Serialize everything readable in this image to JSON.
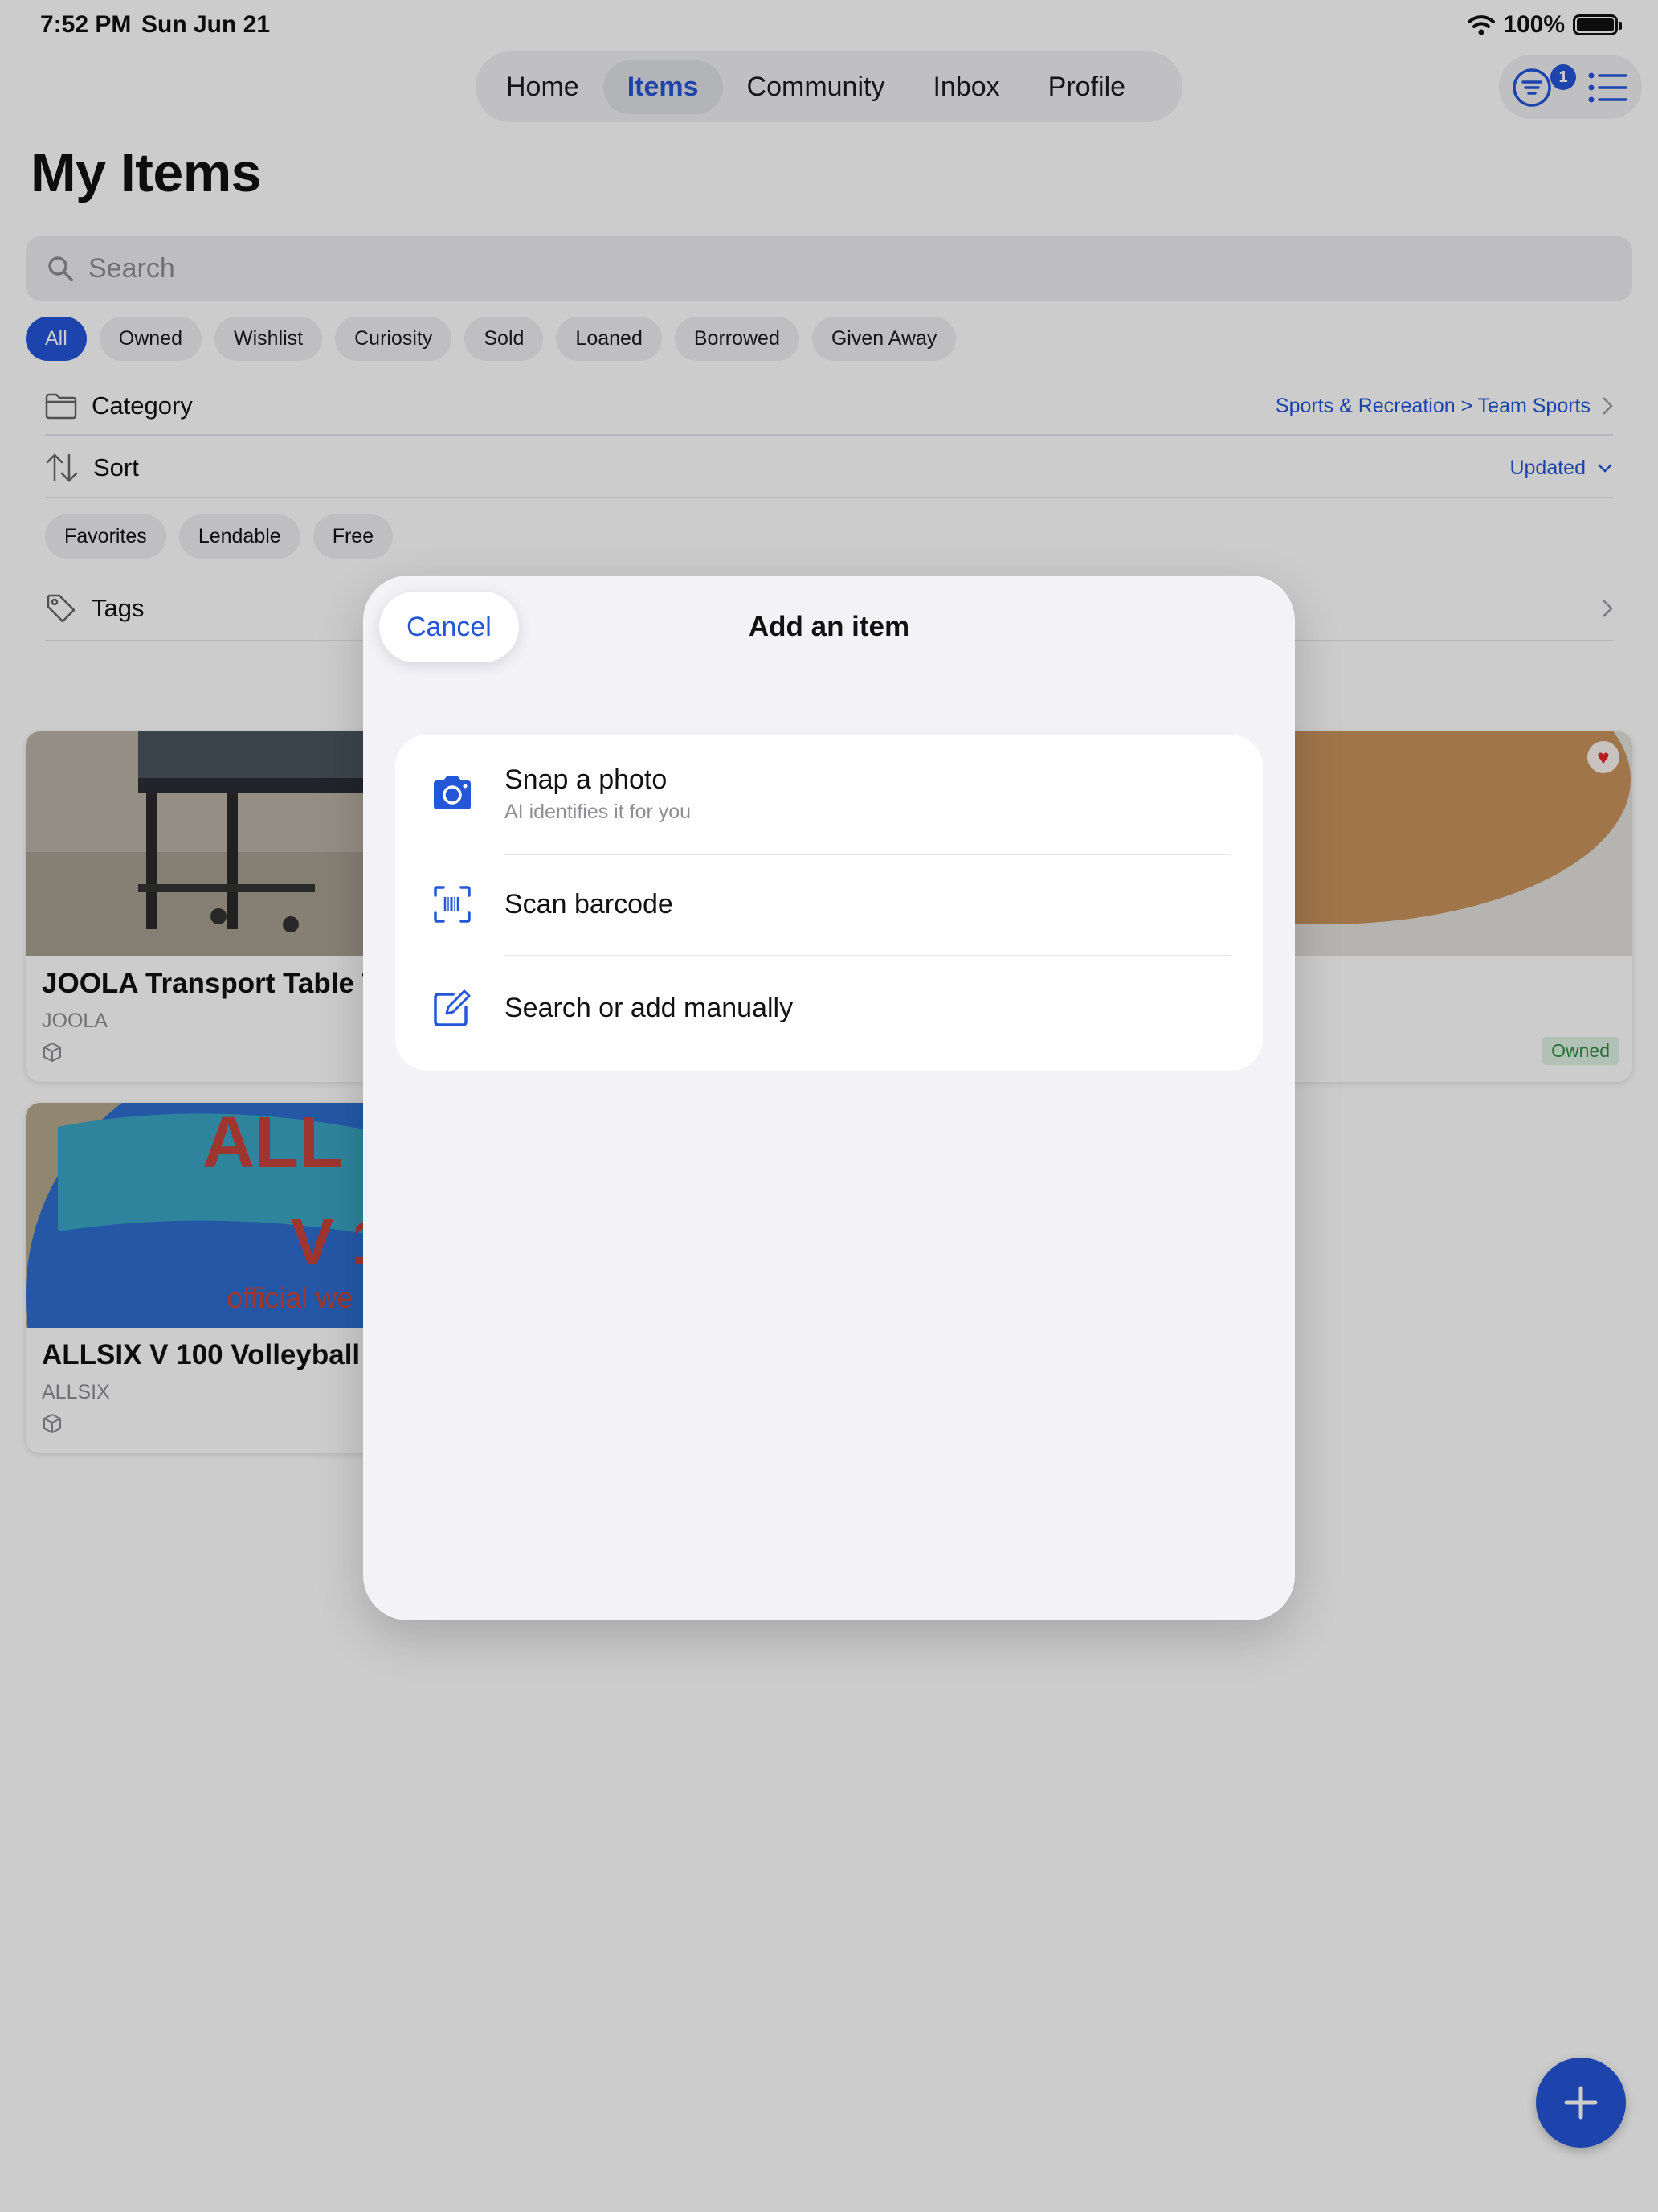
{
  "status": {
    "time": "7:52 PM",
    "date": "Sun Jun 21",
    "battery": "100%"
  },
  "nav": {
    "tabs": [
      {
        "label": "Home"
      },
      {
        "label": "Items"
      },
      {
        "label": "Community"
      },
      {
        "label": "Inbox"
      },
      {
        "label": "Profile"
      }
    ],
    "active_tab": "Items",
    "filter_badge": "1"
  },
  "page": {
    "title": "My Items"
  },
  "search": {
    "placeholder": "Search"
  },
  "filters": {
    "chips": [
      "All",
      "Owned",
      "Wishlist",
      "Curiosity",
      "Sold",
      "Loaned",
      "Borrowed",
      "Given Away"
    ],
    "active": "All"
  },
  "category": {
    "label": "Category",
    "value": "Sports & Recreation > Team Sports"
  },
  "sort": {
    "label": "Sort",
    "value": "Updated"
  },
  "flags": [
    "Favorites",
    "Lendable",
    "Free"
  ],
  "tags": {
    "label": "Tags"
  },
  "items": [
    {
      "name": "JOOLA Transport Table Te",
      "brand": "JOOLA"
    },
    {
      "status": "Owned",
      "favorite": true
    },
    {
      "name": "ALLSIX V 100 Volleyball",
      "brand": "ALLSIX"
    }
  ],
  "modal": {
    "title": "Add an item",
    "cancel": "Cancel",
    "options": [
      {
        "label": "Snap a photo",
        "subtitle": "AI identifies it for you",
        "icon": "camera-icon"
      },
      {
        "label": "Scan barcode",
        "icon": "barcode-scan-icon"
      },
      {
        "label": "Search or add manually",
        "icon": "compose-icon"
      }
    ]
  },
  "colors": {
    "accent": "#2456d8",
    "owned_badge": "#2e8b3f",
    "sheet_bg": "#f2f2f7"
  }
}
